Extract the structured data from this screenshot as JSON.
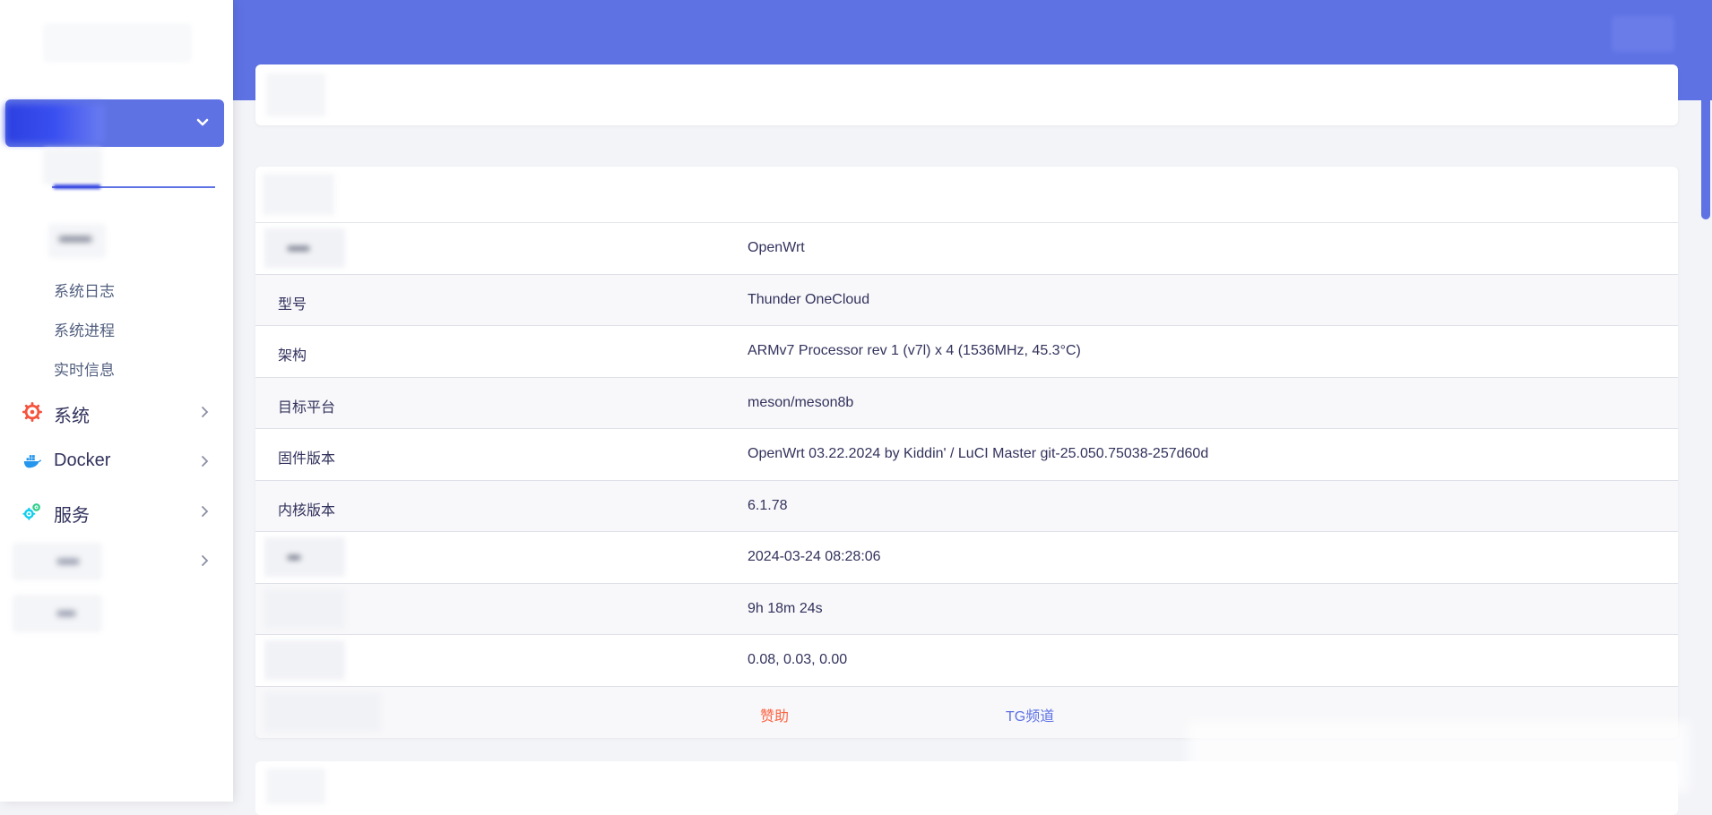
{
  "sidebar": {
    "logo": "logo",
    "status_menu": {
      "chevron_icon": "chevron-down-icon",
      "sub_items": [
        {
          "label": "系统日志"
        },
        {
          "label": "系统进程"
        },
        {
          "label": "实时信息"
        }
      ]
    },
    "menu": [
      {
        "label": "系统",
        "icon": "gear-icon",
        "icon_color": "#f5533d"
      },
      {
        "label": "Docker",
        "icon": "docker-icon",
        "icon_color": "#2496ed"
      },
      {
        "label": "服务",
        "icon": "services-gears-icon",
        "icon_color": "#11cdef"
      }
    ]
  },
  "header": {
    "accent_color": "#5e72e4"
  },
  "system_info": {
    "rows": [
      {
        "label": "",
        "value": "OpenWrt"
      },
      {
        "label": "型号",
        "value": "Thunder OneCloud"
      },
      {
        "label": "架构",
        "value": "ARMv7 Processor rev 1 (v7l) x 4 (1536MHz, 45.3°C)"
      },
      {
        "label": "目标平台",
        "value": "meson/meson8b"
      },
      {
        "label": "固件版本",
        "value": "OpenWrt 03.22.2024 by Kiddin' / LuCI Master git-25.050.75038-257d60d"
      },
      {
        "label": "内核版本",
        "value": "6.1.78"
      },
      {
        "label": "",
        "value": "2024-03-24 08:28:06"
      },
      {
        "label": "",
        "value": "9h 18m 24s"
      },
      {
        "label": "",
        "value": "0.08, 0.03, 0.00"
      }
    ],
    "links": {
      "sponsor": "赞助",
      "tg_channel": "TG频道",
      "sponsor_color": "#fb6340",
      "tg_color": "#5e72e4"
    }
  }
}
